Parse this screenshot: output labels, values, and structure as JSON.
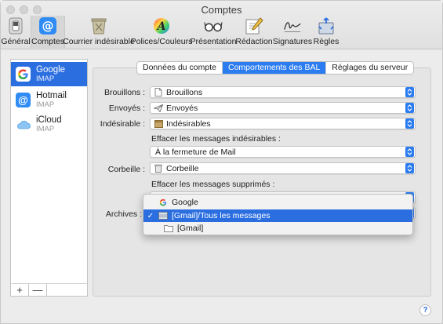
{
  "window": {
    "title": "Comptes"
  },
  "toolbar": {
    "items": [
      {
        "label": "Général",
        "icon": "switch-icon"
      },
      {
        "label": "Comptes",
        "icon": "at-icon"
      },
      {
        "label": "Courrier indésirable",
        "icon": "junk-bin-icon"
      },
      {
        "label": "Polices/Couleurs",
        "icon": "font-icon"
      },
      {
        "label": "Présentation",
        "icon": "glasses-icon"
      },
      {
        "label": "Rédaction",
        "icon": "pencil-icon"
      },
      {
        "label": "Signatures",
        "icon": "signature-icon"
      },
      {
        "label": "Règles",
        "icon": "rules-icon"
      }
    ],
    "active_index": 1
  },
  "sidebar": {
    "accounts": [
      {
        "name": "Google",
        "type": "IMAP",
        "icon": "google-icon"
      },
      {
        "name": "Hotmail",
        "type": "IMAP",
        "icon": "at-icon"
      },
      {
        "name": "iCloud",
        "type": "IMAP",
        "icon": "cloud-icon"
      }
    ],
    "selected_index": 0,
    "add_label": "+",
    "remove_label": "—"
  },
  "tabs": [
    {
      "label": "Données du compte"
    },
    {
      "label": "Comportements des BAL"
    },
    {
      "label": "Réglages du serveur"
    }
  ],
  "active_tab": 1,
  "form": {
    "brouillons": {
      "label": "Brouillons :",
      "value": "Brouillons"
    },
    "envoyes": {
      "label": "Envoyés :",
      "value": "Envoyés"
    },
    "indesirable": {
      "label": "Indésirable :",
      "value": "Indésirables"
    },
    "effacer_indesirables": {
      "label": "Effacer les messages indésirables :",
      "value": "À la fermeture de Mail"
    },
    "corbeille": {
      "label": "Corbeille :",
      "value": "Corbeille"
    },
    "effacer_supprimes": {
      "label": "Effacer les messages supprimés :"
    },
    "archives": {
      "label": "Archives :"
    }
  },
  "archives_menu": {
    "items": [
      {
        "label": "Google",
        "icon": "google-icon",
        "checked": false,
        "highlighted": false
      },
      {
        "label": "[Gmail]/Tous les messages",
        "icon": "archive-box-icon",
        "checked": true,
        "highlighted": true
      },
      {
        "label": "[Gmail]",
        "icon": "folder-icon",
        "checked": false,
        "highlighted": false
      }
    ],
    "check_glyph": "✓"
  },
  "help": {
    "label": "?"
  },
  "colors": {
    "accent": "#2b6ee0",
    "tab_active": "#2b7cf0"
  }
}
